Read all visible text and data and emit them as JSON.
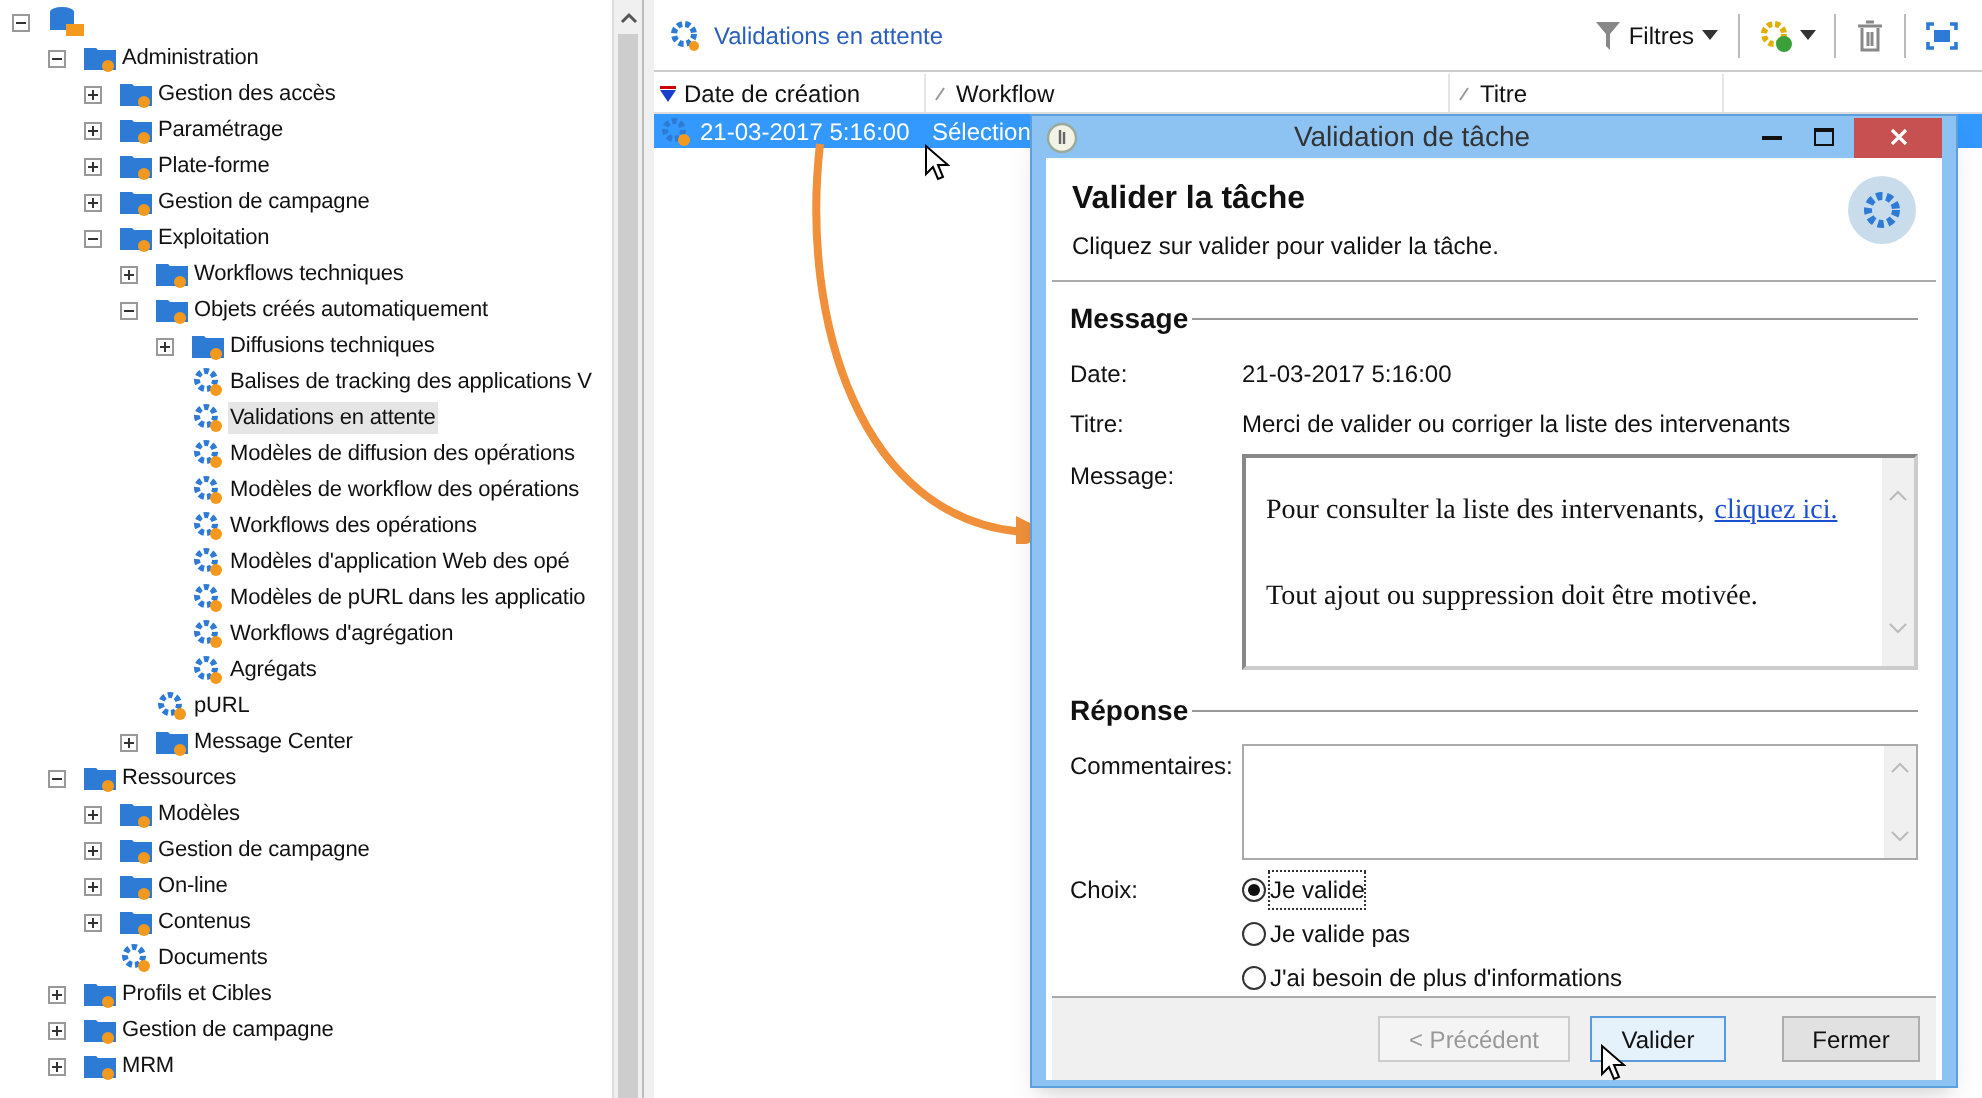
{
  "tree": [
    {
      "kind": "folder",
      "expanded": true,
      "children": [
        {
          "label": "Administration",
          "kind": "folder",
          "expanded": true,
          "selected": false,
          "children": [
            {
              "label": "Gestion des accès",
              "kind": "folder",
              "expanded": false,
              "selected": false
            },
            {
              "label": "Paramétrage",
              "kind": "folder",
              "expanded": false,
              "selected": false
            },
            {
              "label": "Plate-forme",
              "kind": "folder",
              "expanded": false,
              "selected": false
            },
            {
              "label": "Gestion de campagne",
              "kind": "folder",
              "expanded": false,
              "selected": false
            },
            {
              "label": "Exploitation",
              "kind": "folder",
              "expanded": true,
              "selected": false,
              "children": [
                {
                  "label": "Workflows techniques",
                  "kind": "folder",
                  "expanded": false,
                  "selected": false
                },
                {
                  "label": "Objets créés automatiquement",
                  "kind": "folder",
                  "expanded": true,
                  "selected": false,
                  "children": [
                    {
                      "label": "Diffusions techniques",
                      "kind": "folder",
                      "expanded": false,
                      "selected": false
                    },
                    {
                      "label": "Balises de tracking des applications V",
                      "kind": "leaf",
                      "selected": false
                    },
                    {
                      "label": "Validations en attente",
                      "kind": "leaf",
                      "selected": true
                    },
                    {
                      "label": "Modèles de diffusion des opérations",
                      "kind": "leaf",
                      "selected": false
                    },
                    {
                      "label": "Modèles de workflow des opérations",
                      "kind": "leaf",
                      "selected": false
                    },
                    {
                      "label": "Workflows des opérations",
                      "kind": "leaf",
                      "selected": false
                    },
                    {
                      "label": "Modèles d'application Web des opé",
                      "kind": "leaf",
                      "selected": false
                    },
                    {
                      "label": "Modèles de pURL dans les applicatio",
                      "kind": "leaf",
                      "selected": false
                    },
                    {
                      "label": "Workflows d'agrégation",
                      "kind": "leaf",
                      "selected": false
                    },
                    {
                      "label": "Agrégats",
                      "kind": "leaf",
                      "selected": false
                    }
                  ]
                },
                {
                  "label": "pURL",
                  "kind": "leaf",
                  "selected": false
                },
                {
                  "label": "Message Center",
                  "kind": "folder",
                  "expanded": false,
                  "selected": false
                }
              ]
            }
          ]
        },
        {
          "label": "Ressources",
          "kind": "folder",
          "expanded": true,
          "selected": false,
          "children": [
            {
              "label": "Modèles",
              "kind": "folder",
              "expanded": false,
              "selected": false
            },
            {
              "label": "Gestion de campagne",
              "kind": "folder",
              "expanded": false,
              "selected": false
            },
            {
              "label": "On-line",
              "kind": "folder",
              "expanded": false,
              "selected": false
            },
            {
              "label": "Contenus",
              "kind": "folder",
              "expanded": false,
              "selected": false
            },
            {
              "label": "Documents",
              "kind": "leaf",
              "selected": false
            }
          ]
        },
        {
          "label": "Profils et Cibles",
          "kind": "folder",
          "expanded": false,
          "selected": false
        },
        {
          "label": "Gestion de campagne",
          "kind": "folder",
          "expanded": false,
          "selected": false
        },
        {
          "label": "MRM",
          "kind": "folder",
          "expanded": false,
          "selected": false
        }
      ]
    }
  ],
  "toolbar": {
    "title": "Validations en attente",
    "filters": "Filtres"
  },
  "table": {
    "columns": [
      {
        "label": "Date de création",
        "sorted": true
      },
      {
        "label": "Workflow",
        "sorted": false
      },
      {
        "label": "Titre",
        "sorted": false
      }
    ],
    "rows": [
      {
        "cells": [
          "21-03-2017 5:16:00",
          "Sélection"
        ],
        "selected": true
      }
    ]
  },
  "dialog": {
    "title": "Validation de tâche",
    "heading": "Valider la tâche",
    "subtitle": "Cliquez sur valider pour valider la tâche.",
    "message_section": "Message",
    "fields": [
      {
        "label": "Date:",
        "value": "21-03-2017 5:16:00"
      },
      {
        "label": "Titre:",
        "value": "Merci de valider ou corriger la liste des intervenants"
      }
    ],
    "message_label": "Message:",
    "message_lines": [
      {
        "text": "Pour consulter la liste des intervenants,",
        "link": "cliquez ici."
      },
      {
        "text": "Tout ajout ou suppression doit être motivée."
      }
    ],
    "response_section": "Réponse",
    "comments_label": "Commentaires:",
    "choice_label": "Choix:",
    "choices": [
      {
        "label": "Je valide",
        "selected": true
      },
      {
        "label": "Je valide pas",
        "selected": false
      },
      {
        "label": "J'ai besoin de plus d'informations",
        "selected": false
      }
    ],
    "buttons": [
      {
        "label": "< Précédent",
        "disabled": true
      },
      {
        "label": "Valider",
        "disabled": false
      },
      {
        "label": "Fermer",
        "disabled": false
      }
    ]
  }
}
